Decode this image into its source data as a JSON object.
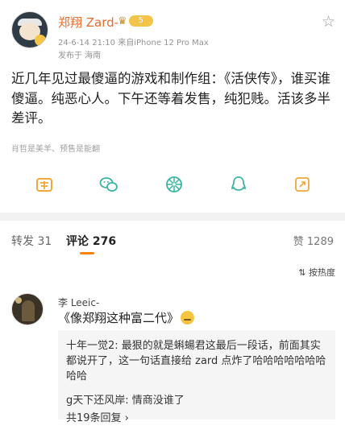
{
  "post": {
    "username": "郑翔 Zard-",
    "badge_level": "5",
    "timestamp": "24-6-14 21:10",
    "device": "来自iPhone 12 Pro Max",
    "location": "发布于 海南",
    "content": "近几年见过最傻逼的游戏和制作组：《活侠传》，谁买谁傻逼。纯恶心人。下午还等着发售，纯犯贱。活该多半差评。",
    "likes_text": "肖哲是美羊、预售是能翻",
    "star_icon": "☆"
  },
  "actions": [
    {
      "name": "reward-icon",
      "color": "#f0a83a"
    },
    {
      "name": "wechat-icon",
      "color": "#3cb4a0"
    },
    {
      "name": "moments-icon",
      "color": "#3cb4a0"
    },
    {
      "name": "qq-icon",
      "color": "#3cb4a0"
    },
    {
      "name": "copy-link-icon",
      "color": "#f0a83a"
    }
  ],
  "tabs": {
    "repost_label": "转发",
    "repost_count": "31",
    "comments_label": "评论",
    "comments_count": "276",
    "likes_label": "赞",
    "likes_count": "1289"
  },
  "sort": {
    "label": "按热度",
    "icon": "⇅"
  },
  "comment": {
    "username": "李 Leeic-",
    "text": "《像郑翔这种富二代》",
    "replies": [
      {
        "name": "十年一觉2",
        "text": "最狠的就是蝌蝪君这最后一段话，前面其实都说开了，这一句话直接给 zard 点炸了哈哈哈哈哈哈哈哈哈"
      },
      {
        "name": "g天下还风岸",
        "text": "情商没谁了"
      },
      {
        "name": "",
        "text": "共19条回复 ›"
      }
    ]
  }
}
